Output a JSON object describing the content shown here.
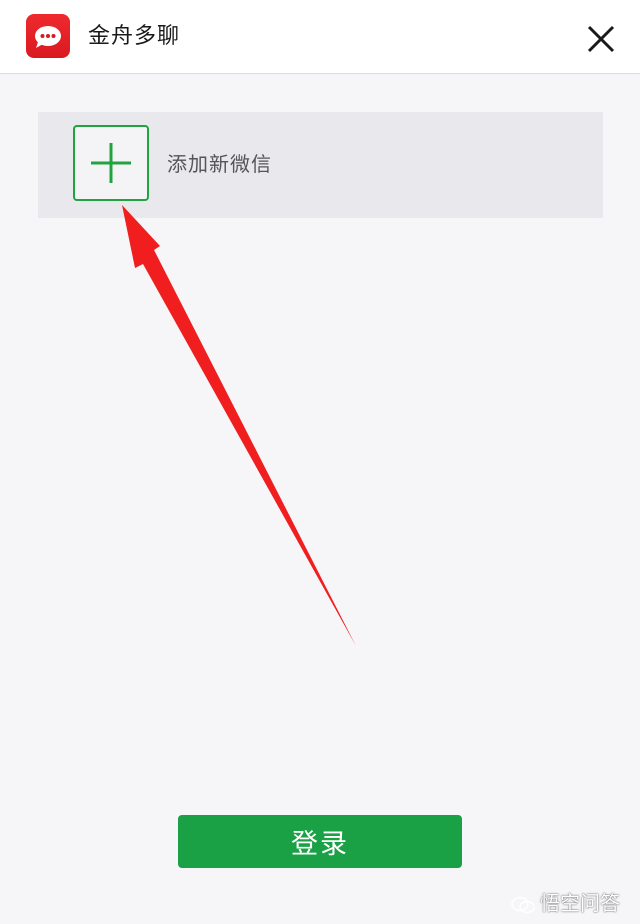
{
  "window": {
    "title": "金舟多聊",
    "logo_icon": "chat-bubble-icon",
    "close_icon": "close-icon"
  },
  "accounts": {
    "add_label": "添加新微信",
    "add_icon": "plus-icon"
  },
  "actions": {
    "login_label": "登录"
  },
  "watermark": {
    "text": "悟空问答"
  },
  "colors": {
    "brand_red": "#e3232a",
    "accent_green": "#1aa045",
    "annotation_red": "#f01e1e"
  }
}
